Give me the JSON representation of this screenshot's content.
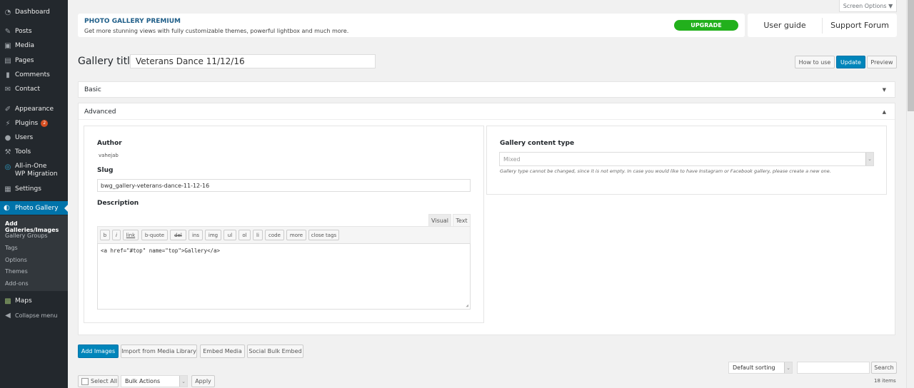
{
  "sidebar": {
    "items": [
      {
        "label": "Dashboard",
        "icon": "dashboard-icon"
      },
      {
        "label": "Posts",
        "icon": "pin-icon"
      },
      {
        "label": "Media",
        "icon": "media-icon"
      },
      {
        "label": "Pages",
        "icon": "pages-icon"
      },
      {
        "label": "Comments",
        "icon": "comment-icon"
      },
      {
        "label": "Contact",
        "icon": "envelope-icon"
      },
      {
        "label": "Appearance",
        "icon": "brush-icon"
      },
      {
        "label": "Plugins",
        "icon": "plugin-icon",
        "badge": "2"
      },
      {
        "label": "Users",
        "icon": "user-icon"
      },
      {
        "label": "Tools",
        "icon": "wrench-icon"
      },
      {
        "label": "All-in-One WP Migration",
        "icon": "migration-icon"
      },
      {
        "label": "Settings",
        "icon": "settings-icon"
      }
    ],
    "active": {
      "label": "Photo Gallery",
      "icon": "photo-gallery-icon"
    },
    "submenu": [
      "Add Galleries/Images",
      "Gallery Groups",
      "Tags",
      "Options",
      "Themes",
      "Add-ons"
    ],
    "after": [
      {
        "label": "Maps",
        "icon": "map-icon"
      },
      {
        "label": "Collapse menu",
        "icon": "collapse-icon"
      }
    ]
  },
  "screen_options": "Screen Options ▼",
  "premium": {
    "title": "PHOTO GALLERY PREMIUM",
    "subtitle": "Get more stunning views with fully customizable themes, powerful lightbox and much more.",
    "upgrade": "UPGRADE",
    "user_guide": "User guide",
    "support_forum": "Support Forum"
  },
  "gallery": {
    "title_label": "Gallery title",
    "title_value": "Veterans Dance 11/12/16",
    "how_to_use": "How to use",
    "update": "Update",
    "preview": "Preview"
  },
  "sections": {
    "basic": "Basic",
    "advanced": "Advanced"
  },
  "advanced": {
    "author_label": "Author",
    "author_value": "vahejab",
    "slug_label": "Slug",
    "slug_value": "bwg_gallery-veterans-dance-11-12-16",
    "description_label": "Description",
    "tab_visual": "Visual",
    "tab_text": "Text",
    "quicktags": [
      "b",
      "i",
      "link",
      "b-quote",
      "del",
      "ins",
      "img",
      "ul",
      "ol",
      "li",
      "code",
      "more",
      "close tags"
    ],
    "editor_content": "<a href=\"#top\" name=\"top\">Gallery</a>",
    "content_type_label": "Gallery content type",
    "content_type_value": "Mixed",
    "content_type_note": "Gallery type cannot be changed, since it is not empty. In case you would like to have Instagram or Facebook gallery, please create a new one."
  },
  "actions": {
    "add_images": "Add Images",
    "import_media": "Import from Media Library",
    "embed_media": "Embed Media",
    "social_bulk_embed": "Social Bulk Embed"
  },
  "list": {
    "select_all": "Select All",
    "bulk_actions": "Bulk Actions",
    "apply": "Apply",
    "sorting": "Default sorting",
    "search_value": "",
    "search_button": "Search",
    "count": "18 items"
  }
}
